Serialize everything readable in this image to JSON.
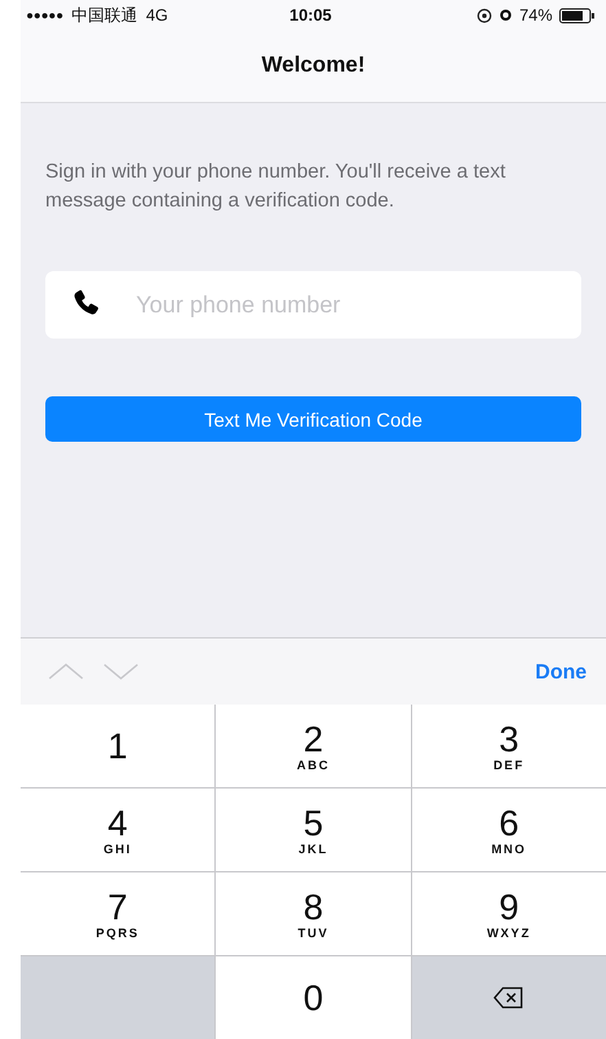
{
  "status_bar": {
    "signal": "●●●●●",
    "carrier": "中国联通",
    "network": "4G",
    "time": "10:05",
    "battery": "74%"
  },
  "nav": {
    "title": "Welcome!"
  },
  "intro": "Sign in with your phone number. You'll receive a text message containing a verification code.",
  "phone_field": {
    "placeholder": "Your phone number"
  },
  "submit_button": "Text Me Verification Code",
  "toolbar": {
    "done": "Done"
  },
  "keys": [
    {
      "kind": "digit",
      "digit": "1"
    },
    {
      "kind": "digit",
      "digit": "2",
      "letters": "ABC"
    },
    {
      "kind": "digit",
      "digit": "3",
      "letters": "DEF"
    },
    {
      "kind": "digit",
      "digit": "4",
      "letters": "GHI"
    },
    {
      "kind": "digit",
      "digit": "5",
      "letters": "JKL"
    },
    {
      "kind": "digit",
      "digit": "6",
      "letters": "MNO"
    },
    {
      "kind": "digit",
      "digit": "7",
      "letters": "PQRS"
    },
    {
      "kind": "digit",
      "digit": "8",
      "letters": "TUV"
    },
    {
      "kind": "digit",
      "digit": "9",
      "letters": "WXYZ"
    },
    {
      "kind": "blank"
    },
    {
      "kind": "digit",
      "digit": "0"
    },
    {
      "kind": "delete"
    }
  ]
}
